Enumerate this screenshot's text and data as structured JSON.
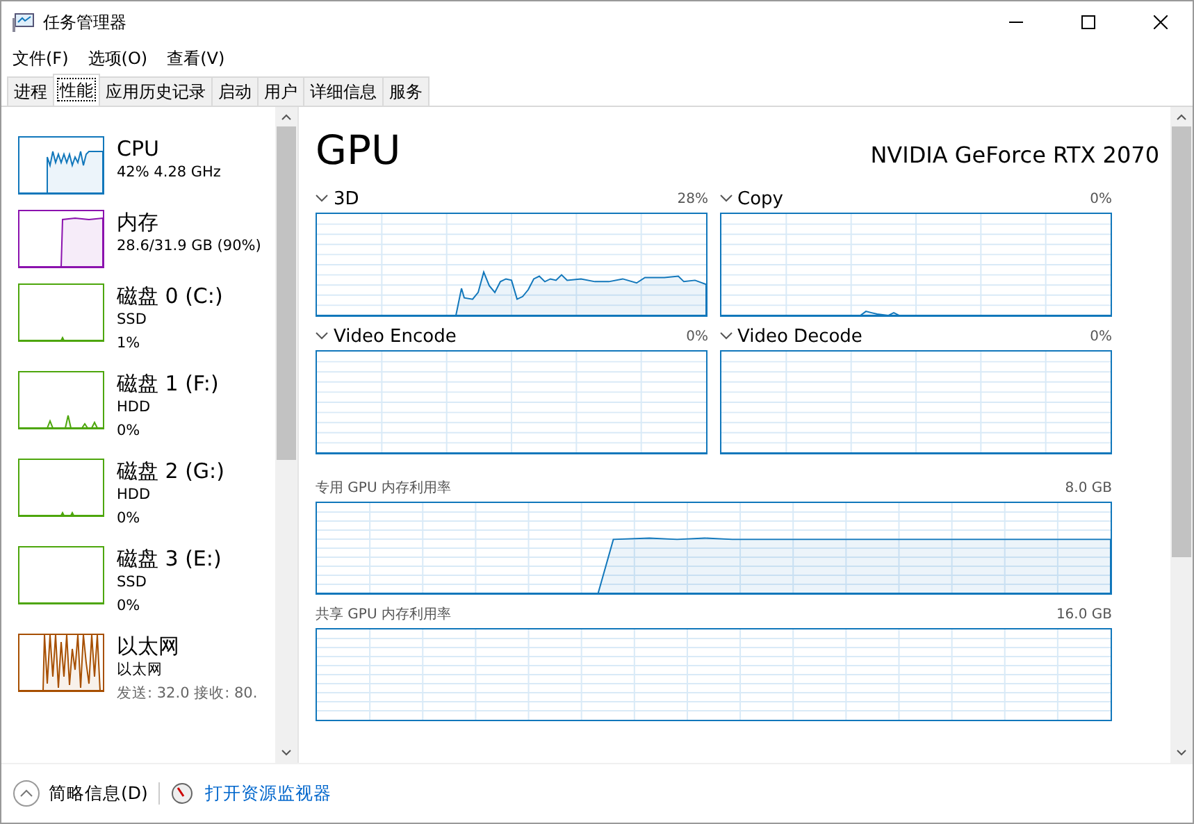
{
  "window": {
    "title": "任务管理器"
  },
  "menu": [
    "文件(F)",
    "选项(O)",
    "查看(V)"
  ],
  "tabs": [
    {
      "label": "进程",
      "selected": false
    },
    {
      "label": "性能",
      "selected": true
    },
    {
      "label": "应用历史记录",
      "selected": false
    },
    {
      "label": "启动",
      "selected": false
    },
    {
      "label": "用户",
      "selected": false
    },
    {
      "label": "详细信息",
      "selected": false
    },
    {
      "label": "服务",
      "selected": false
    }
  ],
  "sidebar": {
    "items": [
      {
        "title": "CPU",
        "lines": [
          "42% 4.28 GHz"
        ],
        "color": "#1177bb"
      },
      {
        "title": "内存",
        "lines": [
          "28.6/31.9 GB (90%)"
        ],
        "color": "#8b12ae"
      },
      {
        "title": "磁盘 0 (C:)",
        "lines": [
          "SSD",
          "1%"
        ],
        "color": "#4da60c"
      },
      {
        "title": "磁盘 1 (F:)",
        "lines": [
          "HDD",
          "0%"
        ],
        "color": "#4da60c"
      },
      {
        "title": "磁盘 2 (G:)",
        "lines": [
          "HDD",
          "0%"
        ],
        "color": "#4da60c"
      },
      {
        "title": "磁盘 3 (E:)",
        "lines": [
          "SSD",
          "0%"
        ],
        "color": "#4da60c"
      },
      {
        "title": "以太网",
        "lines": [
          "以太网",
          "发送: 32.0 接收: 80."
        ],
        "color": "#a74f01"
      }
    ]
  },
  "detail": {
    "title": "GPU",
    "device": "NVIDIA GeForce RTX 2070",
    "engines": [
      {
        "name": "3D",
        "value": "28%"
      },
      {
        "name": "Copy",
        "value": "0%"
      },
      {
        "name": "Video Encode",
        "value": "0%"
      },
      {
        "name": "Video Decode",
        "value": "0%"
      }
    ],
    "memory": [
      {
        "label": "专用 GPU 内存利用率",
        "max": "8.0 GB"
      },
      {
        "label": "共享 GPU 内存利用率",
        "max": "16.0 GB"
      }
    ]
  },
  "footer": {
    "summary": "简略信息(D)",
    "link": "打开资源监视器"
  }
}
